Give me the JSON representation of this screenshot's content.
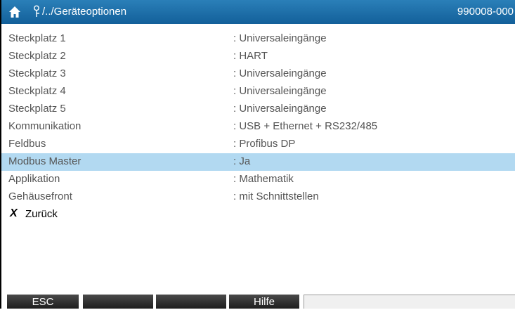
{
  "header": {
    "home_icon": "home-icon",
    "path_icon": "tree-path-icon",
    "path": "/../Geräteoptionen",
    "serial": "990008-000",
    "colors": {
      "background": "#1d6fa5",
      "text": "#ffffff"
    }
  },
  "options": [
    {
      "label": "Steckplatz 1",
      "value": ": Universaleingänge"
    },
    {
      "label": "Steckplatz 2",
      "value": ": HART"
    },
    {
      "label": "Steckplatz 3",
      "value": ": Universaleingänge"
    },
    {
      "label": "Steckplatz 4",
      "value": ": Universaleingänge"
    },
    {
      "label": "Steckplatz 5",
      "value": ": Universaleingänge"
    },
    {
      "label": "Kommunikation",
      "value": ": USB + Ethernet + RS232/485"
    },
    {
      "label": "Feldbus",
      "value": ": Profibus DP"
    },
    {
      "label": "Modbus Master",
      "value": ": Ja",
      "selected": true
    },
    {
      "label": "Applikation",
      "value": ": Mathematik"
    },
    {
      "label": "Gehäusefront",
      "value": ": mit Schnittstellen"
    }
  ],
  "back": {
    "icon": "X",
    "label": "Zurück"
  },
  "softkeys": [
    {
      "label": "ESC"
    },
    {
      "label": ""
    },
    {
      "label": ""
    },
    {
      "label": "Hilfe"
    },
    {
      "label": ""
    }
  ],
  "colors": {
    "selected_row": "#b2d9f1",
    "softkey_bg": "#2d2d2d",
    "text": "#555555"
  }
}
